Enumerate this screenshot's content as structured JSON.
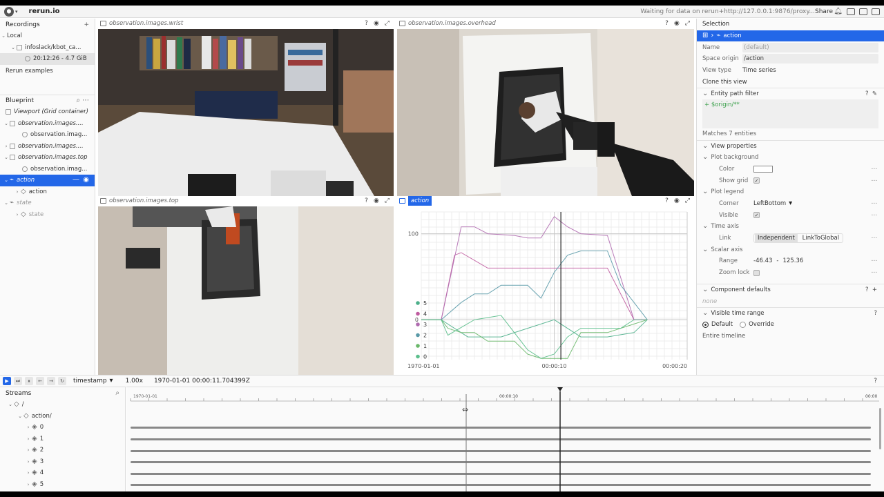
{
  "app": {
    "title": "rerun.io",
    "status": "Waiting for data on rerun+http://127.0.0.1:9876/proxy...",
    "share_label": "Share"
  },
  "recordings": {
    "title": "Recordings",
    "local_label": "Local",
    "dataset": "infoslack/kbot_ca...",
    "recording": "20:12:26 - 4.7 GiB",
    "examples_label": "Rerun examples"
  },
  "blueprint": {
    "title": "Blueprint",
    "viewport": "Viewport (Grid container)",
    "items": [
      {
        "label": "observation.images....",
        "child": "observation.imag..."
      },
      {
        "label": "observation.images...."
      },
      {
        "label": "observation.images.top",
        "child": "observation.imag..."
      },
      {
        "label": "action",
        "child": "action"
      },
      {
        "label": "state",
        "child": "state"
      }
    ]
  },
  "views": {
    "wrist": "observation.images.wrist",
    "overhead": "observation.images.overhead",
    "top": "observation.images.top",
    "action": "action",
    "ctl_help": "?"
  },
  "chart_data": {
    "type": "line",
    "title": "",
    "xlabel": "",
    "ylabel": "",
    "x_ticks": [
      "1970-01-01",
      "00:00:10",
      "00:00:20"
    ],
    "y_ticks": [
      "100",
      "0"
    ],
    "xlim": [
      0,
      20
    ],
    "ylim": [
      -46.43,
      125.36
    ],
    "legend_placement": "bottom-left",
    "series": [
      {
        "name": "5",
        "color": "#4caf8a",
        "values": [
          [
            0,
            0
          ],
          [
            1.5,
            0
          ],
          [
            3.5,
            -20
          ],
          [
            6,
            -20
          ],
          [
            8,
            -10
          ],
          [
            10,
            0
          ],
          [
            12,
            -20
          ],
          [
            14,
            -20
          ],
          [
            16,
            -15
          ],
          [
            17,
            0
          ]
        ]
      },
      {
        "name": "4",
        "color": "#c05ca0",
        "values": [
          [
            0,
            0
          ],
          [
            1.5,
            0
          ],
          [
            2.5,
            75
          ],
          [
            3,
            78
          ],
          [
            5,
            60
          ],
          [
            7,
            60
          ],
          [
            9,
            60
          ],
          [
            11,
            60
          ],
          [
            13,
            60
          ],
          [
            14,
            60
          ],
          [
            16,
            0
          ],
          [
            17,
            0
          ]
        ]
      },
      {
        "name": "3",
        "color": "#b06cb0",
        "values": [
          [
            0,
            0
          ],
          [
            1.5,
            0
          ],
          [
            3,
            108
          ],
          [
            4,
            108
          ],
          [
            5,
            100
          ],
          [
            7,
            98
          ],
          [
            8,
            95
          ],
          [
            9,
            95
          ],
          [
            10,
            120
          ],
          [
            11,
            108
          ],
          [
            12,
            100
          ],
          [
            14,
            98
          ],
          [
            16,
            0
          ],
          [
            17,
            0
          ]
        ]
      },
      {
        "name": "2",
        "color": "#5a9aa8",
        "values": [
          [
            0,
            0
          ],
          [
            1.5,
            0
          ],
          [
            3,
            20
          ],
          [
            4,
            30
          ],
          [
            5,
            30
          ],
          [
            6,
            40
          ],
          [
            8,
            40
          ],
          [
            9,
            25
          ],
          [
            10,
            55
          ],
          [
            11,
            75
          ],
          [
            12,
            80
          ],
          [
            14,
            80
          ],
          [
            15,
            40
          ],
          [
            16,
            20
          ],
          [
            17,
            0
          ]
        ]
      },
      {
        "name": "1",
        "color": "#6ab86a",
        "values": [
          [
            0,
            0
          ],
          [
            1.5,
            0
          ],
          [
            2,
            -10
          ],
          [
            3,
            -15
          ],
          [
            4,
            -15
          ],
          [
            5,
            -25
          ],
          [
            7,
            -25
          ],
          [
            8,
            -40
          ],
          [
            9,
            -45
          ],
          [
            10,
            -45
          ],
          [
            11,
            -45
          ],
          [
            12,
            -15
          ],
          [
            14,
            -15
          ],
          [
            16,
            -5
          ],
          [
            17,
            0
          ]
        ]
      },
      {
        "name": "0",
        "color": "#5cbf8c",
        "values": [
          [
            0,
            0
          ],
          [
            1.5,
            0
          ],
          [
            2,
            -18
          ],
          [
            4,
            0
          ],
          [
            6,
            5
          ],
          [
            8,
            -35
          ],
          [
            9,
            -45
          ],
          [
            10,
            -40
          ],
          [
            11,
            -20
          ],
          [
            12,
            -10
          ],
          [
            14,
            -10
          ],
          [
            15,
            -10
          ],
          [
            16,
            0
          ],
          [
            17,
            0
          ]
        ]
      }
    ],
    "cursor_x": 10.5
  },
  "selection": {
    "title": "Selection",
    "selected": "action",
    "name_label": "Name",
    "name_value": "(default)",
    "origin_label": "Space origin",
    "origin_value": "/action",
    "type_label": "View type",
    "type_value": "Time series",
    "clone_label": "Clone this view",
    "filter_title": "Entity path filter",
    "filter_value": "+ $origin/**",
    "matches": "Matches 7 entities",
    "view_props": "View properties",
    "plot_bg": "Plot background",
    "color_label": "Color",
    "show_grid_label": "Show grid",
    "plot_legend": "Plot legend",
    "corner_label": "Corner",
    "corner_value": "LeftBottom",
    "visible_label": "Visible",
    "time_axis": "Time axis",
    "link_label": "Link",
    "link_opt1": "Independent",
    "link_opt2": "LinkToGlobal",
    "scalar_axis": "Scalar axis",
    "range_label": "Range",
    "range_min": "-46.43",
    "range_sep": "-",
    "range_max": "125.36",
    "zoom_lock_label": "Zoom lock",
    "component_defaults": "Component defaults",
    "none_label": "none",
    "visible_time_range": "Visible time range",
    "default_label": "Default",
    "override_label": "Override",
    "entire_timeline": "Entire timeline"
  },
  "timebar": {
    "timeline": "timestamp",
    "speed": "1.00x",
    "current": "1970-01-01 00:00:11.704399Z",
    "help": "?"
  },
  "streams": {
    "title": "Streams",
    "root": "/",
    "action": "action/",
    "children": [
      "0",
      "1",
      "2",
      "3",
      "4",
      "5"
    ]
  },
  "timeline_ticks": [
    "1970-01-01",
    "00:00:10",
    "00:00"
  ]
}
